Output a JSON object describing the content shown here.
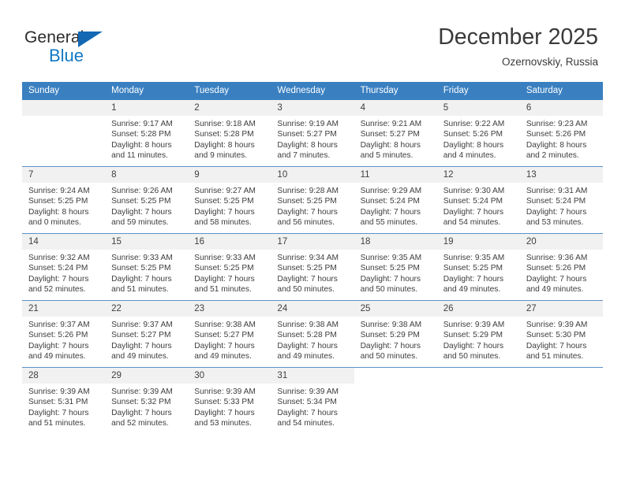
{
  "brand": {
    "name_top": "General",
    "name_bottom": "Blue",
    "accent_color": "#1279c4",
    "triangle_color": "#1268b3"
  },
  "header": {
    "title": "December 2025",
    "location": "Ozernovskiy, Russia",
    "header_bg": "#3a80c1",
    "daynum_bg": "#f1f1f1"
  },
  "weekday_headers": [
    "Sunday",
    "Monday",
    "Tuesday",
    "Wednesday",
    "Thursday",
    "Friday",
    "Saturday"
  ],
  "labels": {
    "sunrise": "Sunrise:",
    "sunset": "Sunset:",
    "daylight": "Daylight:"
  },
  "weeks": [
    [
      {
        "day": "",
        "sunrise": "",
        "sunset": "",
        "daylight1": "",
        "daylight2": "",
        "empty": true
      },
      {
        "day": "1",
        "sunrise": "Sunrise: 9:17 AM",
        "sunset": "Sunset: 5:28 PM",
        "daylight1": "Daylight: 8 hours",
        "daylight2": "and 11 minutes."
      },
      {
        "day": "2",
        "sunrise": "Sunrise: 9:18 AM",
        "sunset": "Sunset: 5:28 PM",
        "daylight1": "Daylight: 8 hours",
        "daylight2": "and 9 minutes."
      },
      {
        "day": "3",
        "sunrise": "Sunrise: 9:19 AM",
        "sunset": "Sunset: 5:27 PM",
        "daylight1": "Daylight: 8 hours",
        "daylight2": "and 7 minutes."
      },
      {
        "day": "4",
        "sunrise": "Sunrise: 9:21 AM",
        "sunset": "Sunset: 5:27 PM",
        "daylight1": "Daylight: 8 hours",
        "daylight2": "and 5 minutes."
      },
      {
        "day": "5",
        "sunrise": "Sunrise: 9:22 AM",
        "sunset": "Sunset: 5:26 PM",
        "daylight1": "Daylight: 8 hours",
        "daylight2": "and 4 minutes."
      },
      {
        "day": "6",
        "sunrise": "Sunrise: 9:23 AM",
        "sunset": "Sunset: 5:26 PM",
        "daylight1": "Daylight: 8 hours",
        "daylight2": "and 2 minutes."
      }
    ],
    [
      {
        "day": "7",
        "sunrise": "Sunrise: 9:24 AM",
        "sunset": "Sunset: 5:25 PM",
        "daylight1": "Daylight: 8 hours",
        "daylight2": "and 0 minutes."
      },
      {
        "day": "8",
        "sunrise": "Sunrise: 9:26 AM",
        "sunset": "Sunset: 5:25 PM",
        "daylight1": "Daylight: 7 hours",
        "daylight2": "and 59 minutes."
      },
      {
        "day": "9",
        "sunrise": "Sunrise: 9:27 AM",
        "sunset": "Sunset: 5:25 PM",
        "daylight1": "Daylight: 7 hours",
        "daylight2": "and 58 minutes."
      },
      {
        "day": "10",
        "sunrise": "Sunrise: 9:28 AM",
        "sunset": "Sunset: 5:25 PM",
        "daylight1": "Daylight: 7 hours",
        "daylight2": "and 56 minutes."
      },
      {
        "day": "11",
        "sunrise": "Sunrise: 9:29 AM",
        "sunset": "Sunset: 5:24 PM",
        "daylight1": "Daylight: 7 hours",
        "daylight2": "and 55 minutes."
      },
      {
        "day": "12",
        "sunrise": "Sunrise: 9:30 AM",
        "sunset": "Sunset: 5:24 PM",
        "daylight1": "Daylight: 7 hours",
        "daylight2": "and 54 minutes."
      },
      {
        "day": "13",
        "sunrise": "Sunrise: 9:31 AM",
        "sunset": "Sunset: 5:24 PM",
        "daylight1": "Daylight: 7 hours",
        "daylight2": "and 53 minutes."
      }
    ],
    [
      {
        "day": "14",
        "sunrise": "Sunrise: 9:32 AM",
        "sunset": "Sunset: 5:24 PM",
        "daylight1": "Daylight: 7 hours",
        "daylight2": "and 52 minutes."
      },
      {
        "day": "15",
        "sunrise": "Sunrise: 9:33 AM",
        "sunset": "Sunset: 5:25 PM",
        "daylight1": "Daylight: 7 hours",
        "daylight2": "and 51 minutes."
      },
      {
        "day": "16",
        "sunrise": "Sunrise: 9:33 AM",
        "sunset": "Sunset: 5:25 PM",
        "daylight1": "Daylight: 7 hours",
        "daylight2": "and 51 minutes."
      },
      {
        "day": "17",
        "sunrise": "Sunrise: 9:34 AM",
        "sunset": "Sunset: 5:25 PM",
        "daylight1": "Daylight: 7 hours",
        "daylight2": "and 50 minutes."
      },
      {
        "day": "18",
        "sunrise": "Sunrise: 9:35 AM",
        "sunset": "Sunset: 5:25 PM",
        "daylight1": "Daylight: 7 hours",
        "daylight2": "and 50 minutes."
      },
      {
        "day": "19",
        "sunrise": "Sunrise: 9:35 AM",
        "sunset": "Sunset: 5:25 PM",
        "daylight1": "Daylight: 7 hours",
        "daylight2": "and 49 minutes."
      },
      {
        "day": "20",
        "sunrise": "Sunrise: 9:36 AM",
        "sunset": "Sunset: 5:26 PM",
        "daylight1": "Daylight: 7 hours",
        "daylight2": "and 49 minutes."
      }
    ],
    [
      {
        "day": "21",
        "sunrise": "Sunrise: 9:37 AM",
        "sunset": "Sunset: 5:26 PM",
        "daylight1": "Daylight: 7 hours",
        "daylight2": "and 49 minutes."
      },
      {
        "day": "22",
        "sunrise": "Sunrise: 9:37 AM",
        "sunset": "Sunset: 5:27 PM",
        "daylight1": "Daylight: 7 hours",
        "daylight2": "and 49 minutes."
      },
      {
        "day": "23",
        "sunrise": "Sunrise: 9:38 AM",
        "sunset": "Sunset: 5:27 PM",
        "daylight1": "Daylight: 7 hours",
        "daylight2": "and 49 minutes."
      },
      {
        "day": "24",
        "sunrise": "Sunrise: 9:38 AM",
        "sunset": "Sunset: 5:28 PM",
        "daylight1": "Daylight: 7 hours",
        "daylight2": "and 49 minutes."
      },
      {
        "day": "25",
        "sunrise": "Sunrise: 9:38 AM",
        "sunset": "Sunset: 5:29 PM",
        "daylight1": "Daylight: 7 hours",
        "daylight2": "and 50 minutes."
      },
      {
        "day": "26",
        "sunrise": "Sunrise: 9:39 AM",
        "sunset": "Sunset: 5:29 PM",
        "daylight1": "Daylight: 7 hours",
        "daylight2": "and 50 minutes."
      },
      {
        "day": "27",
        "sunrise": "Sunrise: 9:39 AM",
        "sunset": "Sunset: 5:30 PM",
        "daylight1": "Daylight: 7 hours",
        "daylight2": "and 51 minutes."
      }
    ],
    [
      {
        "day": "28",
        "sunrise": "Sunrise: 9:39 AM",
        "sunset": "Sunset: 5:31 PM",
        "daylight1": "Daylight: 7 hours",
        "daylight2": "and 51 minutes."
      },
      {
        "day": "29",
        "sunrise": "Sunrise: 9:39 AM",
        "sunset": "Sunset: 5:32 PM",
        "daylight1": "Daylight: 7 hours",
        "daylight2": "and 52 minutes."
      },
      {
        "day": "30",
        "sunrise": "Sunrise: 9:39 AM",
        "sunset": "Sunset: 5:33 PM",
        "daylight1": "Daylight: 7 hours",
        "daylight2": "and 53 minutes."
      },
      {
        "day": "31",
        "sunrise": "Sunrise: 9:39 AM",
        "sunset": "Sunset: 5:34 PM",
        "daylight1": "Daylight: 7 hours",
        "daylight2": "and 54 minutes."
      },
      {
        "day": "",
        "sunrise": "",
        "sunset": "",
        "daylight1": "",
        "daylight2": "",
        "empty": true,
        "blank": true
      },
      {
        "day": "",
        "sunrise": "",
        "sunset": "",
        "daylight1": "",
        "daylight2": "",
        "empty": true,
        "blank": true
      },
      {
        "day": "",
        "sunrise": "",
        "sunset": "",
        "daylight1": "",
        "daylight2": "",
        "empty": true,
        "blank": true
      }
    ]
  ]
}
